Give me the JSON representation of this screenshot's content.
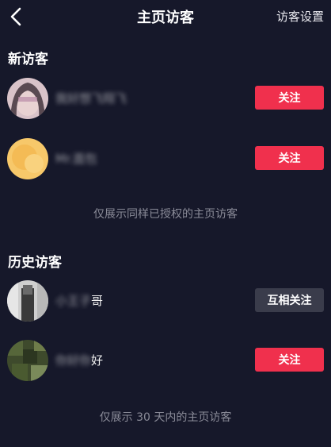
{
  "header": {
    "title": "主页访客",
    "settings_label": "访客设置"
  },
  "sections": {
    "new": {
      "title": "新访客",
      "notice": "仅展示同样已授权的主页访客",
      "visitors": [
        {
          "name_blur": "我好想飞翔飞",
          "name_clear": "",
          "button": "关注"
        },
        {
          "name_blur": "Mr.面包",
          "name_clear": "",
          "button": "关注"
        }
      ]
    },
    "history": {
      "title": "历史访客",
      "notice": "仅展示 30 天内的主页访客",
      "visitors": [
        {
          "name_blur": "小王子",
          "name_clear": "哥",
          "button": "互相关注"
        },
        {
          "name_blur": "你好你",
          "name_clear": "好",
          "button": "关注"
        }
      ]
    }
  },
  "colors": {
    "background": "#16182a",
    "follow_button": "#f0304d",
    "mutual_button": "#3a3c4b",
    "notice_text": "#8a8b98"
  },
  "icons": {
    "back": "chevron-left-icon"
  }
}
